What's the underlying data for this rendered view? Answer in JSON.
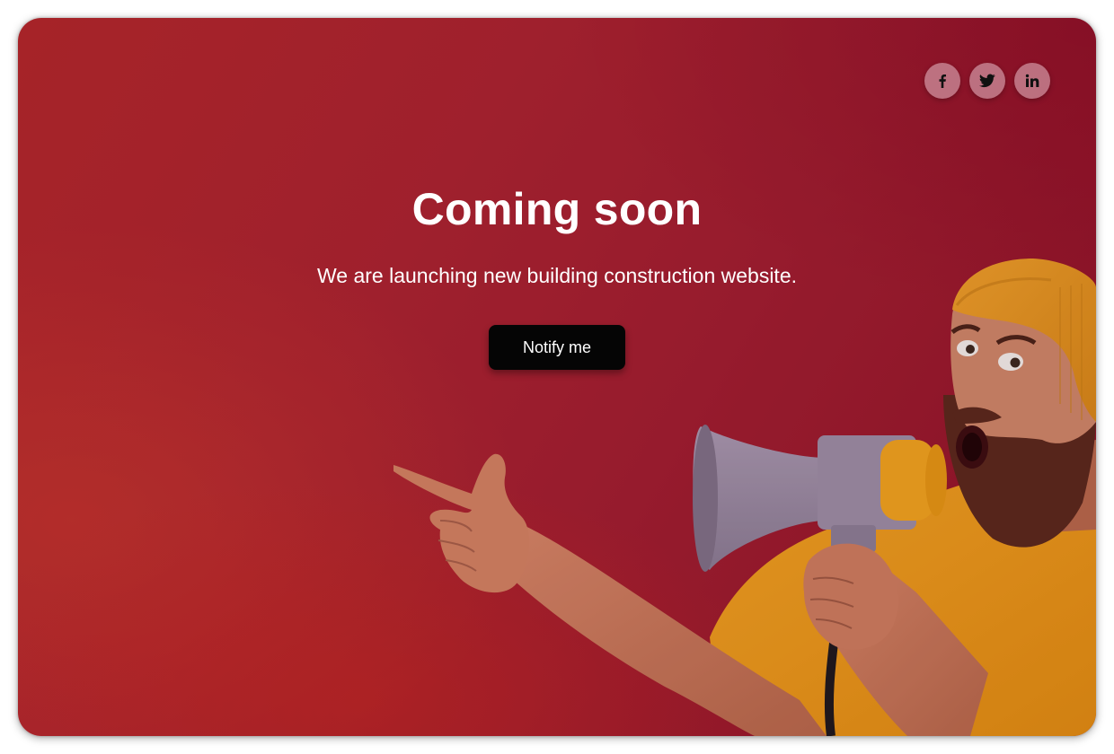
{
  "hero": {
    "title": "Coming soon",
    "subtitle": "We are launching new building construction website.",
    "notify_label": "Notify me"
  },
  "social": [
    {
      "name": "facebook-icon",
      "glyph": "f"
    },
    {
      "name": "twitter-icon",
      "glyph": "bird"
    },
    {
      "name": "linkedin-icon",
      "glyph": "in"
    }
  ],
  "colors": {
    "background": "#a8232f",
    "button": "#050505",
    "text": "#ffffff",
    "shirt": "#f5a21b",
    "megaphone": "#9b8fa6"
  }
}
